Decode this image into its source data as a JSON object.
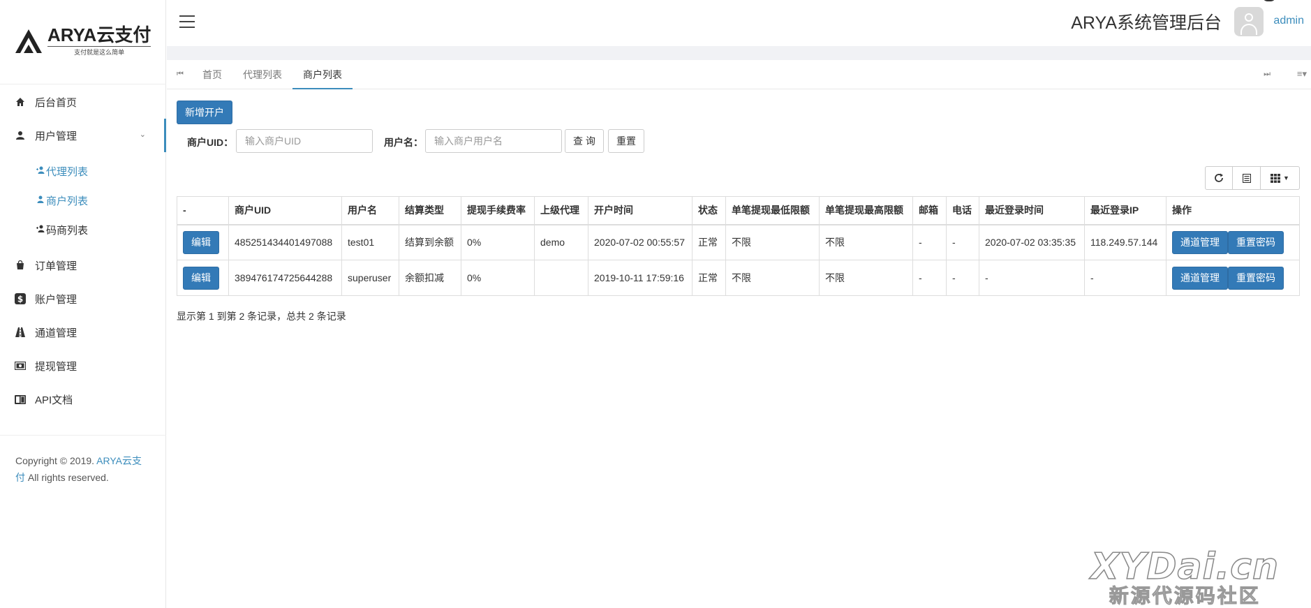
{
  "brand": {
    "name": "ARYA云支付",
    "tagline": "支付就是这么简单"
  },
  "sidebar": {
    "items": [
      {
        "label": "后台首页",
        "icon": "home-icon"
      },
      {
        "label": "用户管理",
        "icon": "user-icon",
        "expanded": true,
        "children": [
          {
            "label": "代理列表",
            "icon": "user-plus-icon"
          },
          {
            "label": "商户列表",
            "icon": "user-icon"
          },
          {
            "label": "码商列表",
            "icon": "user-plus-icon"
          }
        ]
      },
      {
        "label": "订单管理",
        "icon": "shopping-bag-icon"
      },
      {
        "label": "账户管理",
        "icon": "dollar-icon"
      },
      {
        "label": "通道管理",
        "icon": "road-icon"
      },
      {
        "label": "提现管理",
        "icon": "money-icon"
      },
      {
        "label": "API文档",
        "icon": "book-icon"
      }
    ],
    "copyright": {
      "prefix": "Copyright © 2019. ",
      "link": "ARYA云支付",
      "suffix": " All rights reserved."
    }
  },
  "header": {
    "title": "ARYA系统管理后台",
    "username": "admin"
  },
  "tabs": [
    {
      "label": "首页",
      "active": false
    },
    {
      "label": "代理列表",
      "active": false
    },
    {
      "label": "商户列表",
      "active": true
    }
  ],
  "toolbar": {
    "add_label": "新增开户"
  },
  "search": {
    "uid_label": "商户UID：",
    "uid_placeholder": "输入商户UID",
    "uid_value": "",
    "name_label": "用户名：",
    "name_placeholder": "输入商户用户名",
    "name_value": "",
    "query_label": "查 询",
    "reset_label": "重置"
  },
  "table": {
    "columns": [
      "-",
      "商户UID",
      "用户名",
      "结算类型",
      "提现手续费率",
      "上级代理",
      "开户时间",
      "状态",
      "单笔提现最低限额",
      "单笔提现最高限额",
      "邮箱",
      "电话",
      "最近登录时间",
      "最近登录IP",
      "操作"
    ],
    "rows": [
      {
        "edit": "编辑",
        "uid": "485251434401497088",
        "username": "test01",
        "settle": "结算到余额",
        "fee": "0%",
        "agent": "demo",
        "created": "2020-07-02 00:55:57",
        "status": "正常",
        "min": "不限",
        "max": "不限",
        "email": "-",
        "phone": "-",
        "last_login": "2020-07-02 03:35:35",
        "last_ip": "118.249.57.144",
        "op1": "通道管理",
        "op2": "重置密码"
      },
      {
        "edit": "编辑",
        "uid": "389476174725644288",
        "username": "superuser",
        "settle": "余额扣减",
        "fee": "0%",
        "agent": "",
        "created": "2019-10-11 17:59:16",
        "status": "正常",
        "min": "不限",
        "max": "不限",
        "email": "-",
        "phone": "-",
        "last_login": "-",
        "last_ip": "-",
        "op1": "通道管理",
        "op2": "重置密码"
      }
    ]
  },
  "pagination": {
    "info": "显示第 1 到第 2 条记录，总共 2 条记录"
  },
  "watermark": {
    "top": "XYDai.cn",
    "bottom": "新源代源码社区"
  },
  "colors": {
    "primary": "#337ab7",
    "link": "#3c8dbc"
  }
}
